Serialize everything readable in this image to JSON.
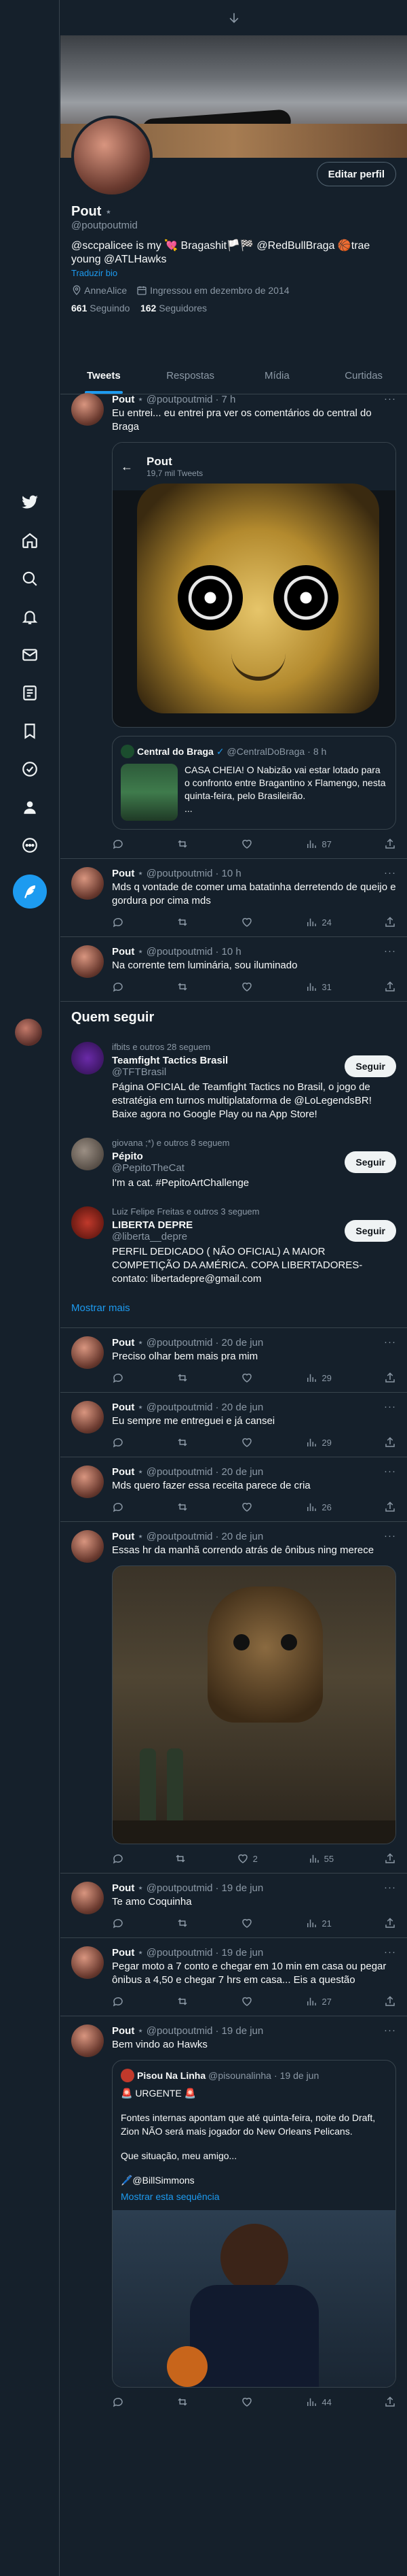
{
  "profile": {
    "display_name": "Pout",
    "handle": "@poutpoutmid",
    "bio_text": "@sccpalicee is my 💘 Bragashit🏳️🏁 @RedBullBraga 🏀trae young @ATLHawks",
    "translate_label": "Traduzir bio",
    "location": "AnneAlice",
    "joined": "Ingressou em dezembro de 2014",
    "following_count": "661",
    "following_label": "Seguindo",
    "followers_count": "162",
    "followers_label": "Seguidores",
    "edit_label": "Editar perfil"
  },
  "tabs": [
    "Tweets",
    "Respostas",
    "Mídia",
    "Curtidas"
  ],
  "tweets": [
    {
      "time": "7 h",
      "text": "Eu entrei... eu entrei pra ver os comentários do central do Braga",
      "reply": "",
      "rt": "",
      "like": "",
      "views": "87"
    },
    {
      "time": "10 h",
      "text": "Mds q vontade de comer uma batatinha derretendo de queijo e gordura por cima mds",
      "reply": "",
      "rt": "",
      "like": "",
      "views": "24"
    },
    {
      "time": "10 h",
      "text": "Na corrente tem luminária, sou iluminado",
      "reply": "",
      "rt": "",
      "like": "",
      "views": "31"
    },
    {
      "time": "20 de jun",
      "text": "Preciso olhar bem mais pra mim",
      "reply": "",
      "rt": "",
      "like": "",
      "views": "29"
    },
    {
      "time": "20 de jun",
      "text": "Eu sempre me entreguei e já cansei",
      "reply": "",
      "rt": "",
      "like": "",
      "views": "29"
    },
    {
      "time": "20 de jun",
      "text": "Mds quero fazer essa receita parece de cria",
      "reply": "",
      "rt": "",
      "like": "",
      "views": "26"
    },
    {
      "time": "20 de jun",
      "text": "Essas hr da manhã correndo atrás de ônibus ning merece",
      "reply": "",
      "rt": "",
      "like": "2",
      "views": "55"
    },
    {
      "time": "19 de jun",
      "text": "Te amo Coquinha",
      "reply": "",
      "rt": "",
      "like": "",
      "views": "21"
    },
    {
      "time": "19 de jun",
      "text": "Pegar moto a 7 conto e chegar em 10 min em casa ou pegar ônibus a 4,50 e chegar 7 hrs em casa... Eis a questão",
      "reply": "",
      "rt": "",
      "like": "",
      "views": "27"
    },
    {
      "time": "19 de jun",
      "text": "Bem vindo ao Hawks",
      "reply": "",
      "rt": "",
      "like": "",
      "views": "44"
    }
  ],
  "embedded_profile": {
    "name": "Pout",
    "sub": "19,7 mil Tweets"
  },
  "quote1": {
    "name": "Central do Braga",
    "handle": "@CentralDoBraga",
    "time": "8 h",
    "text": "CASA CHEIA! O Nabizão vai estar lotado para o confronto entre Bragantino x Flamengo, nesta quinta-feira, pelo Brasileirão.",
    "ellipsis": "..."
  },
  "quote2": {
    "name": "Pisou Na Linha",
    "handle": "@pisounalinha",
    "time": "19 de jun",
    "line1": "🚨 URGENTE 🚨",
    "text": "Fontes internas apontam que até quinta-feira, noite do Draft, Zion NÃO será mais jogador do New Orleans Pelicans.",
    "text2": "Que situação, meu amigo...",
    "credit": "🖊️@BillSimmons",
    "thread_link": "Mostrar esta sequência"
  },
  "who_to_follow": {
    "title": "Quem seguir",
    "more": "Mostrar mais",
    "follow_label": "Seguir",
    "items": [
      {
        "social": "ifbits e outros 28 seguem",
        "name": "Teamfight Tactics Brasil",
        "handle": "@TFTBrasil",
        "bio": "Página OFICIAL de Teamfight Tactics no Brasil, o jogo de estratégia em turnos multiplataforma de @LoLegendsBR! Baixe agora no Google Play ou na App Store!"
      },
      {
        "social": "giovana ;*) e outros 8 seguem",
        "name": "Pépito",
        "handle": "@PepitoTheCat",
        "bio": "I'm a cat. #PepitoArtChallenge"
      },
      {
        "social": "Luiz Felipe Freitas e outros 3 seguem",
        "name": "LIBERTA DEPRE",
        "handle": "@liberta__depre",
        "bio": "PERFIL DEDICADO ( NÃO OFICIAL) A MAIOR COMPETIÇÃO DA AMÉRICA. COPA LIBERTADORES- contato: libertadepre@gmail.com"
      }
    ]
  },
  "colors": {
    "bg": "#15202b",
    "accent": "#1d9bf0",
    "border": "#38444d",
    "muted": "#8b98a5"
  }
}
